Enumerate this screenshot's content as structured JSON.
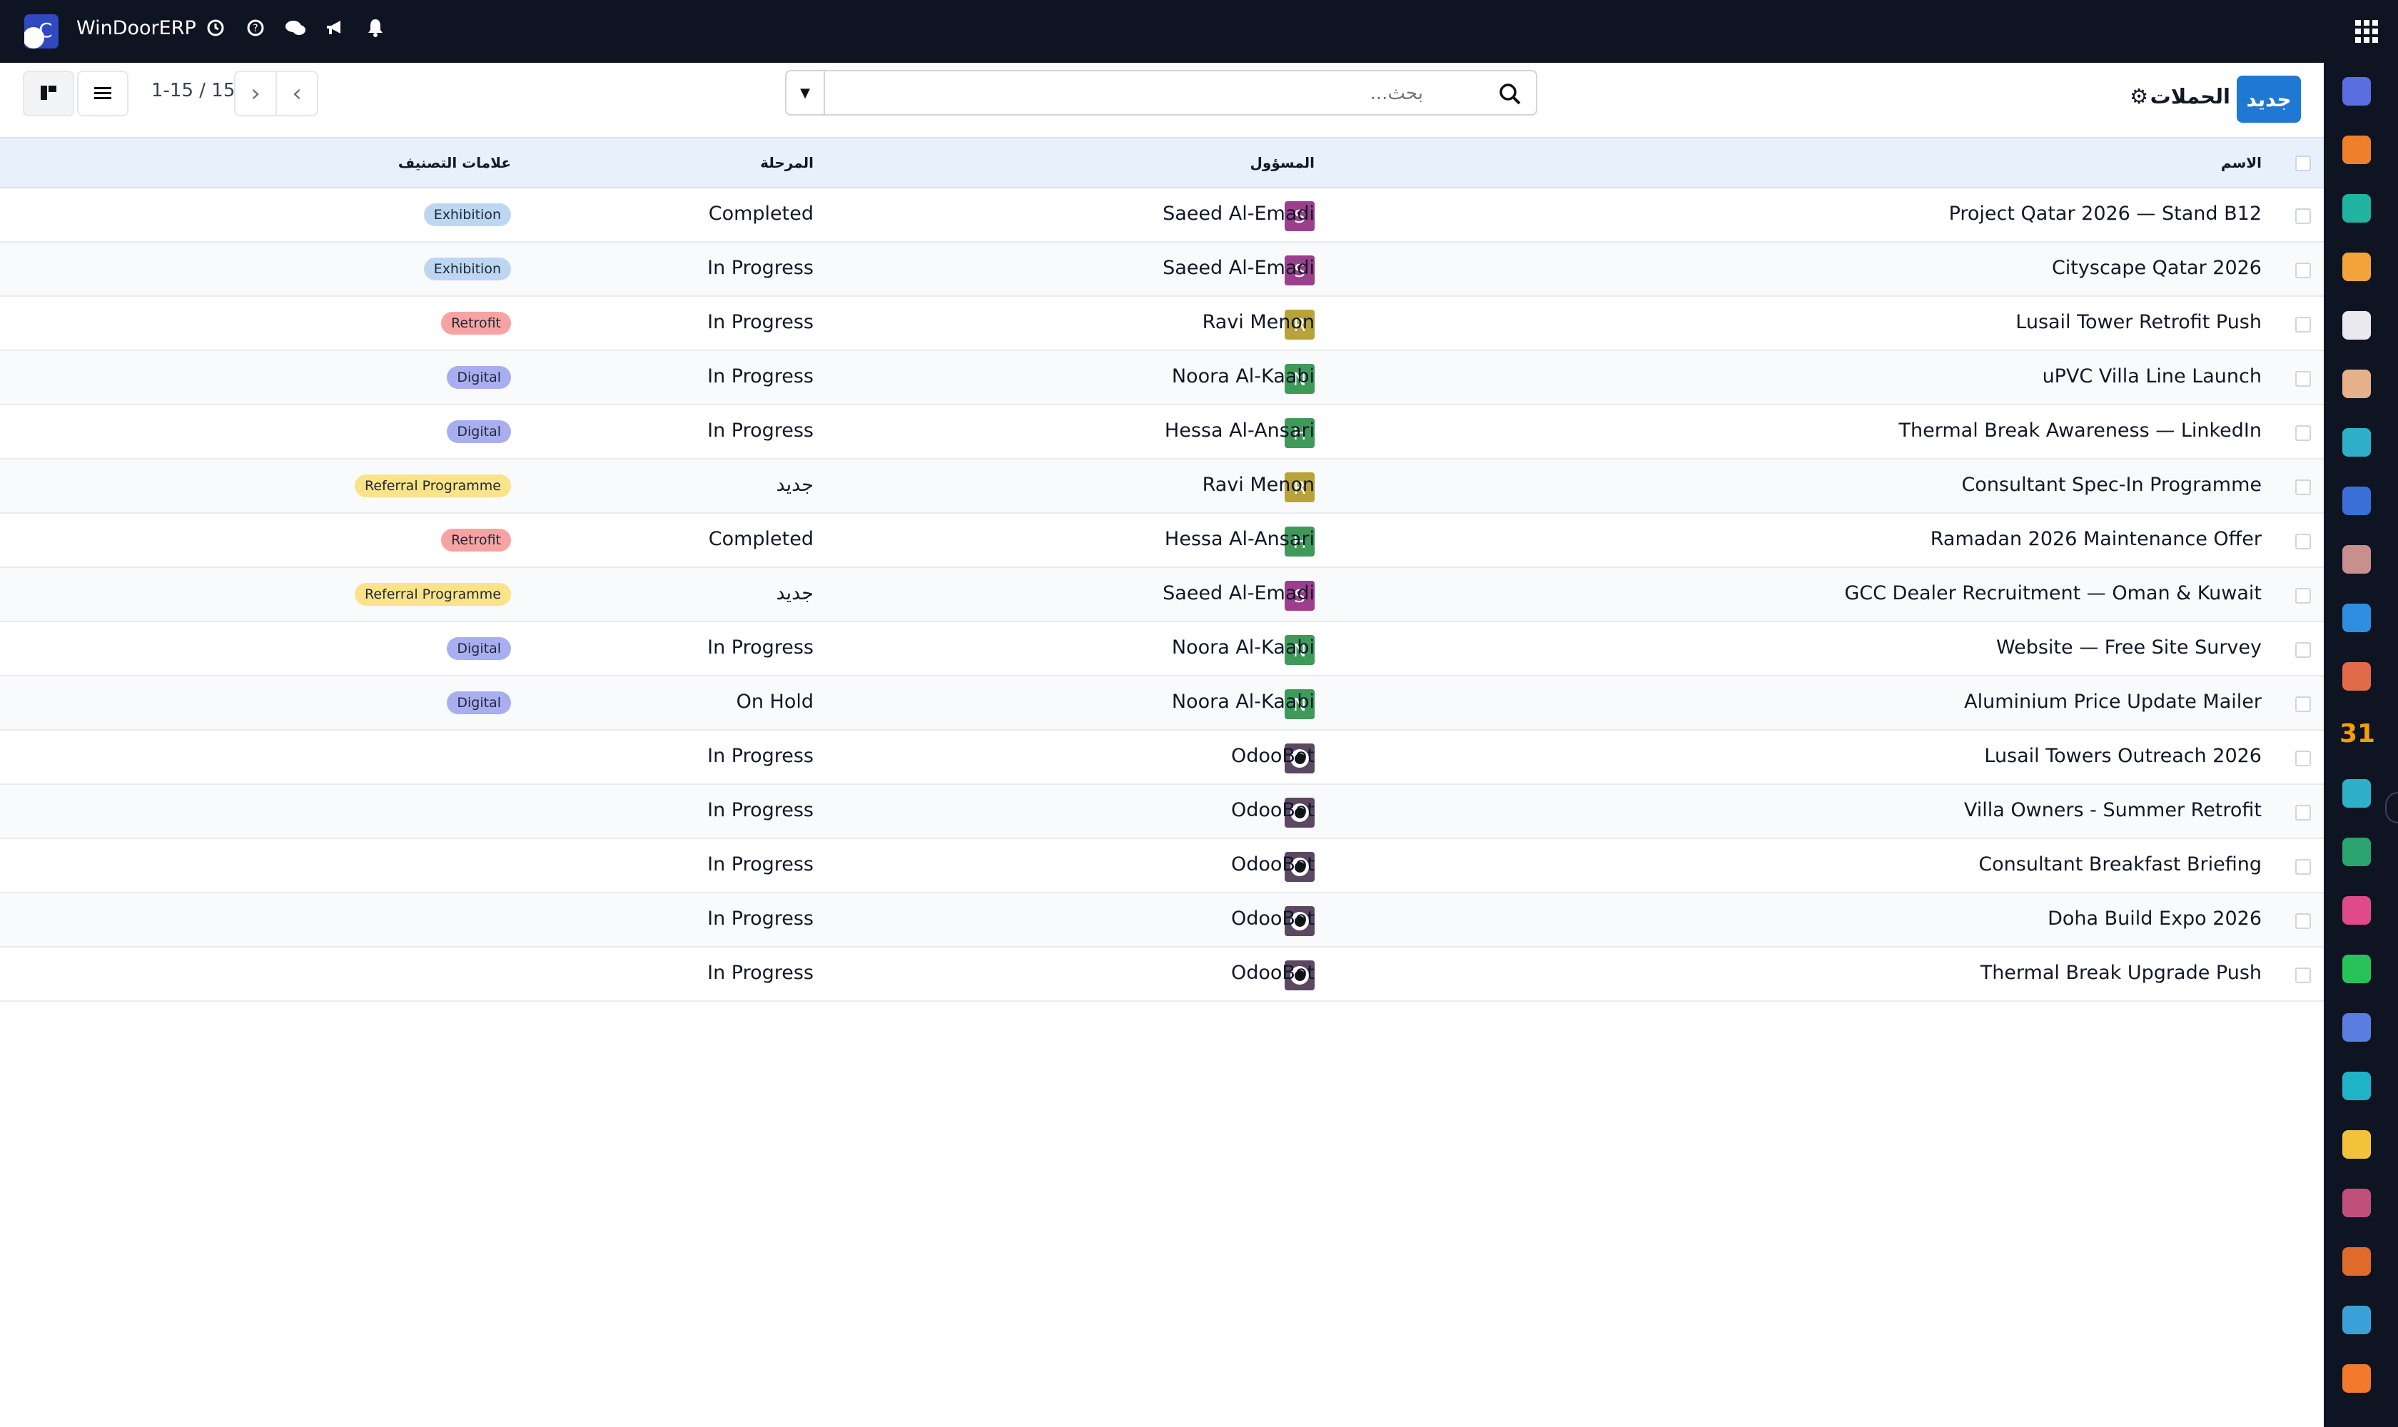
{
  "navbar": {
    "app_name": "WinDoorERP",
    "logo_letter": "C"
  },
  "control": {
    "new_button": "جديد",
    "title": "الحملات",
    "search_placeholder": "بحث...",
    "pager": "1-15 / 15"
  },
  "columns": {
    "name": "الاسم",
    "responsible": "المسؤول",
    "stage": "المرحلة",
    "tags": "علامات التصنيف"
  },
  "rows": [
    {
      "name": "Project Qatar 2026 — Stand B12",
      "responsible": "Saeed Al-Emadi",
      "initial": "S",
      "avatar_color": "#9b3f8c",
      "stage": "Completed",
      "tag": "Exhibition",
      "tag_color": "#bdd7f2"
    },
    {
      "name": "Cityscape Qatar 2026",
      "responsible": "Saeed Al-Emadi",
      "initial": "S",
      "avatar_color": "#9b3f8c",
      "stage": "In Progress",
      "tag": "Exhibition",
      "tag_color": "#bdd7f2"
    },
    {
      "name": "Lusail Tower Retrofit Push",
      "responsible": "Ravi Menon",
      "initial": "R",
      "avatar_color": "#b8a33a",
      "stage": "In Progress",
      "tag": "Retrofit",
      "tag_color": "#f8a3a3"
    },
    {
      "name": "uPVC Villa Line Launch",
      "responsible": "Noora Al-Kaabi",
      "initial": "N",
      "avatar_color": "#3f9a5a",
      "stage": "In Progress",
      "tag": "Digital",
      "tag_color": "#a8aef0"
    },
    {
      "name": "Thermal Break Awareness — LinkedIn",
      "responsible": "Hessa Al-Ansari",
      "initial": "H",
      "avatar_color": "#3f9a5a",
      "stage": "In Progress",
      "tag": "Digital",
      "tag_color": "#a8aef0"
    },
    {
      "name": "Consultant Spec-In Programme",
      "responsible": "Ravi Menon",
      "initial": "R",
      "avatar_color": "#b8a33a",
      "stage": "جديد",
      "tag": "Referral Programme",
      "tag_color": "#fbe38a"
    },
    {
      "name": "Ramadan 2026 Maintenance Offer",
      "responsible": "Hessa Al-Ansari",
      "initial": "H",
      "avatar_color": "#3f9a5a",
      "stage": "Completed",
      "tag": "Retrofit",
      "tag_color": "#f8a3a3"
    },
    {
      "name": "GCC Dealer Recruitment — Oman & Kuwait",
      "responsible": "Saeed Al-Emadi",
      "initial": "S",
      "avatar_color": "#9b3f8c",
      "stage": "جديد",
      "tag": "Referral Programme",
      "tag_color": "#fbe38a"
    },
    {
      "name": "Website — Free Site Survey",
      "responsible": "Noora Al-Kaabi",
      "initial": "N",
      "avatar_color": "#3f9a5a",
      "stage": "In Progress",
      "tag": "Digital",
      "tag_color": "#a8aef0"
    },
    {
      "name": "Aluminium Price Update Mailer",
      "responsible": "Noora Al-Kaabi",
      "initial": "N",
      "avatar_color": "#3f9a5a",
      "stage": "On Hold",
      "tag": "Digital",
      "tag_color": "#a8aef0"
    },
    {
      "name": "Lusail Towers Outreach 2026",
      "responsible": "OdooBot",
      "initial": "",
      "avatar_color": "bot",
      "stage": "In Progress",
      "tag": "",
      "tag_color": ""
    },
    {
      "name": "Villa Owners - Summer Retrofit",
      "responsible": "OdooBot",
      "initial": "",
      "avatar_color": "bot",
      "stage": "In Progress",
      "tag": "",
      "tag_color": ""
    },
    {
      "name": "Consultant Breakfast Briefing",
      "responsible": "OdooBot",
      "initial": "",
      "avatar_color": "bot",
      "stage": "In Progress",
      "tag": "",
      "tag_color": ""
    },
    {
      "name": "Doha Build Expo 2026",
      "responsible": "OdooBot",
      "initial": "",
      "avatar_color": "bot",
      "stage": "In Progress",
      "tag": "",
      "tag_color": ""
    },
    {
      "name": "Thermal Break Upgrade Push",
      "responsible": "OdooBot",
      "initial": "",
      "avatar_color": "bot",
      "stage": "In Progress",
      "tag": "",
      "tag_color": ""
    }
  ],
  "sidebar_apps": [
    {
      "icon": "email-marketing-icon",
      "color": "#5b6ee0"
    },
    {
      "icon": "discuss-icon",
      "color": "#f07f2a"
    },
    {
      "icon": "crm-icon",
      "color": "#1fb3a0"
    },
    {
      "icon": "sales-icon",
      "color": "#f2a33a"
    },
    {
      "icon": "inventory-icon",
      "color": "#e9e9ee"
    },
    {
      "icon": "contacts-icon",
      "color": "#e6b18a"
    },
    {
      "icon": "project-icon",
      "color": "#2fb0c8"
    },
    {
      "icon": "knowledge-icon",
      "color": "#3a6fd8"
    },
    {
      "icon": "purchase-icon",
      "color": "#c98f8f"
    },
    {
      "icon": "invoicing-icon",
      "color": "#2f8ee0"
    },
    {
      "icon": "employees-icon",
      "color": "#e06a4a"
    },
    {
      "icon": "calendar-icon",
      "color": "#f59e0b",
      "text": "31"
    },
    {
      "icon": "sign-icon",
      "color": "#2fb0c8"
    },
    {
      "icon": "members-icon",
      "color": "#2aa36f"
    },
    {
      "icon": "dashboards-icon",
      "color": "#e04a8a"
    },
    {
      "icon": "whatsapp-icon",
      "color": "#27c258"
    },
    {
      "icon": "timesheets-icon",
      "color": "#5a7de0"
    },
    {
      "icon": "website-icon",
      "color": "#1fb3c8"
    },
    {
      "icon": "sms-marketing-icon",
      "color": "#f2c33a"
    },
    {
      "icon": "events-icon",
      "color": "#c0507a"
    },
    {
      "icon": "surveys-icon",
      "color": "#e06a2a"
    },
    {
      "icon": "social-icon",
      "color": "#3aa0d8"
    },
    {
      "icon": "apps-icon",
      "color": "#f27a2a"
    }
  ]
}
